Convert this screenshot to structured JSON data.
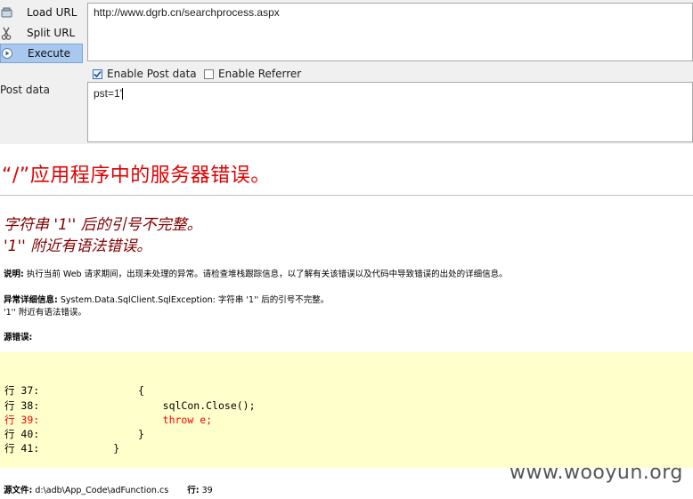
{
  "toolbar": {
    "load_url": "Load URL",
    "split_url": "Split URL",
    "execute": "Execute",
    "url_value": "http://www.dgrb.cn/searchprocess.aspx",
    "enable_post": "Enable Post data",
    "enable_post_checked": true,
    "enable_referrer": "Enable Referrer",
    "enable_referrer_checked": false,
    "post_label": "Post data",
    "post_value": "pst=1'"
  },
  "error": {
    "title": "“/”应用程序中的服务器错误。",
    "sub1": "字符串 '1'' 后的引号不完整。",
    "sub2": "'1'' 附近有语法错误。",
    "desc_label": "说明:",
    "desc_text": "执行当前 Web 请求期间，出现未处理的异常。请检查堆栈跟踪信息，以了解有关该错误以及代码中导致错误的出处的详细信息。",
    "detail_label": "异常详细信息:",
    "detail_text": "System.Data.SqlClient.SqlException: 字符串 '1'' 后的引号不完整。",
    "detail_text2": "'1'' 附近有语法错误。",
    "source_label": "源错误:",
    "code": [
      "行 37:                {",
      "行 38:                    sqlCon.Close();",
      "行 39:                    throw e;",
      "行 40:                }",
      "行 41:            }"
    ],
    "file_label": "源文件:",
    "file_value": "d:\\adb\\App_Code\\adFunction.cs",
    "line_label": "行:",
    "line_value": "39",
    "watermark": "www.wooyun.org"
  }
}
